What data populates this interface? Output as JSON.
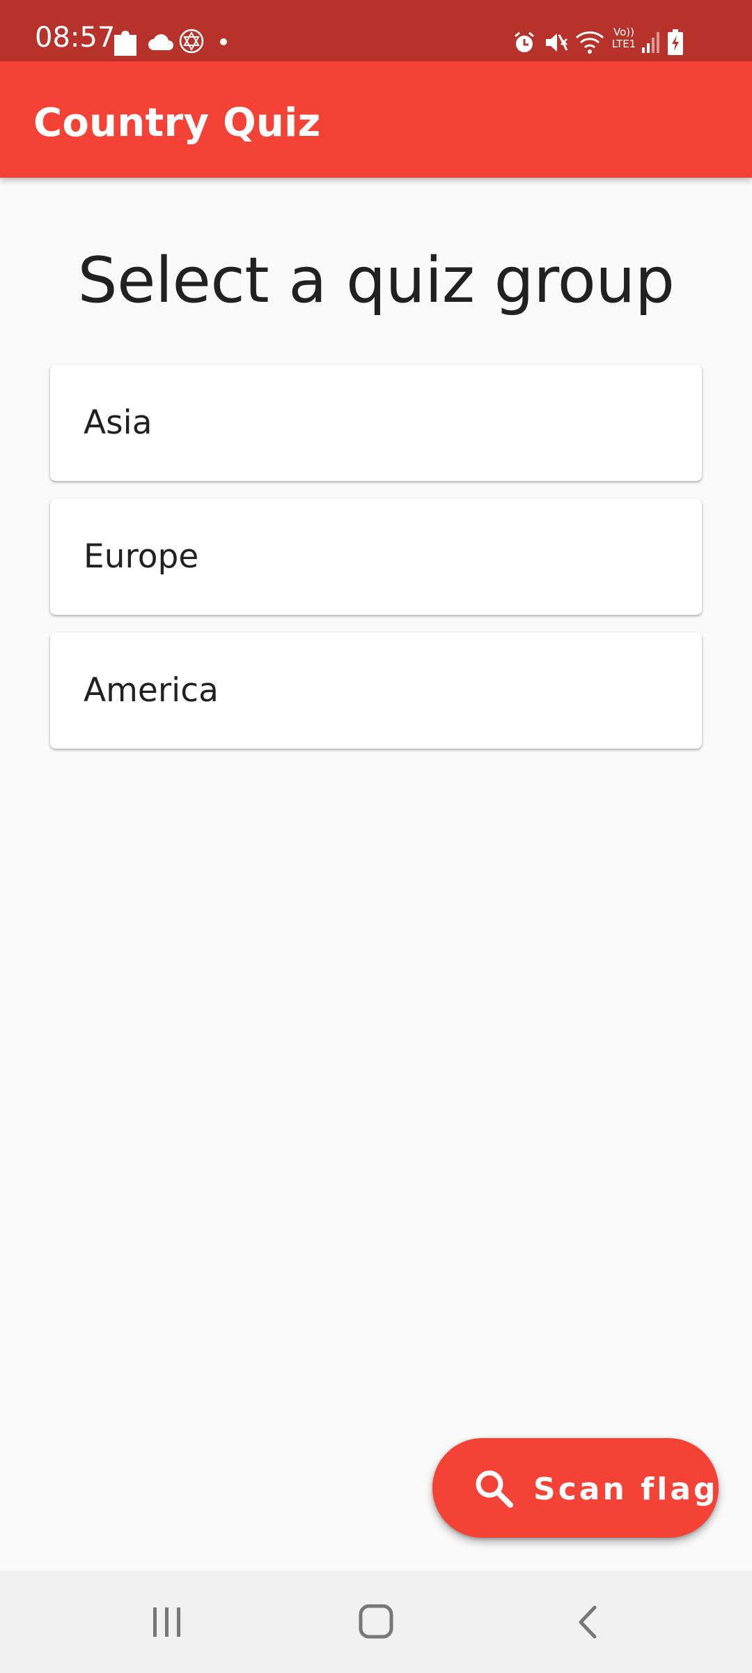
{
  "status_bar": {
    "time": "08:57",
    "left_icons": [
      "puzzle-icon",
      "cloud-icon",
      "star-of-david-icon",
      "dot-icon"
    ],
    "right_icons": [
      "alarm-icon",
      "mute-icon",
      "wifi-icon",
      "volte-icon",
      "signal-icon",
      "battery-charging-icon"
    ],
    "network_text_top": "Vo))",
    "network_text_bottom": "LTE1"
  },
  "app_bar": {
    "title": "Country Quiz",
    "color": "#f44336"
  },
  "main": {
    "heading": "Select a quiz group",
    "groups": [
      {
        "label": "Asia"
      },
      {
        "label": "Europe"
      },
      {
        "label": "America"
      }
    ]
  },
  "fab": {
    "label": "Scan flag",
    "icon": "search-icon",
    "color": "#f44336"
  },
  "nav_bar": {
    "buttons": [
      "recents-icon",
      "home-icon",
      "back-icon"
    ]
  }
}
